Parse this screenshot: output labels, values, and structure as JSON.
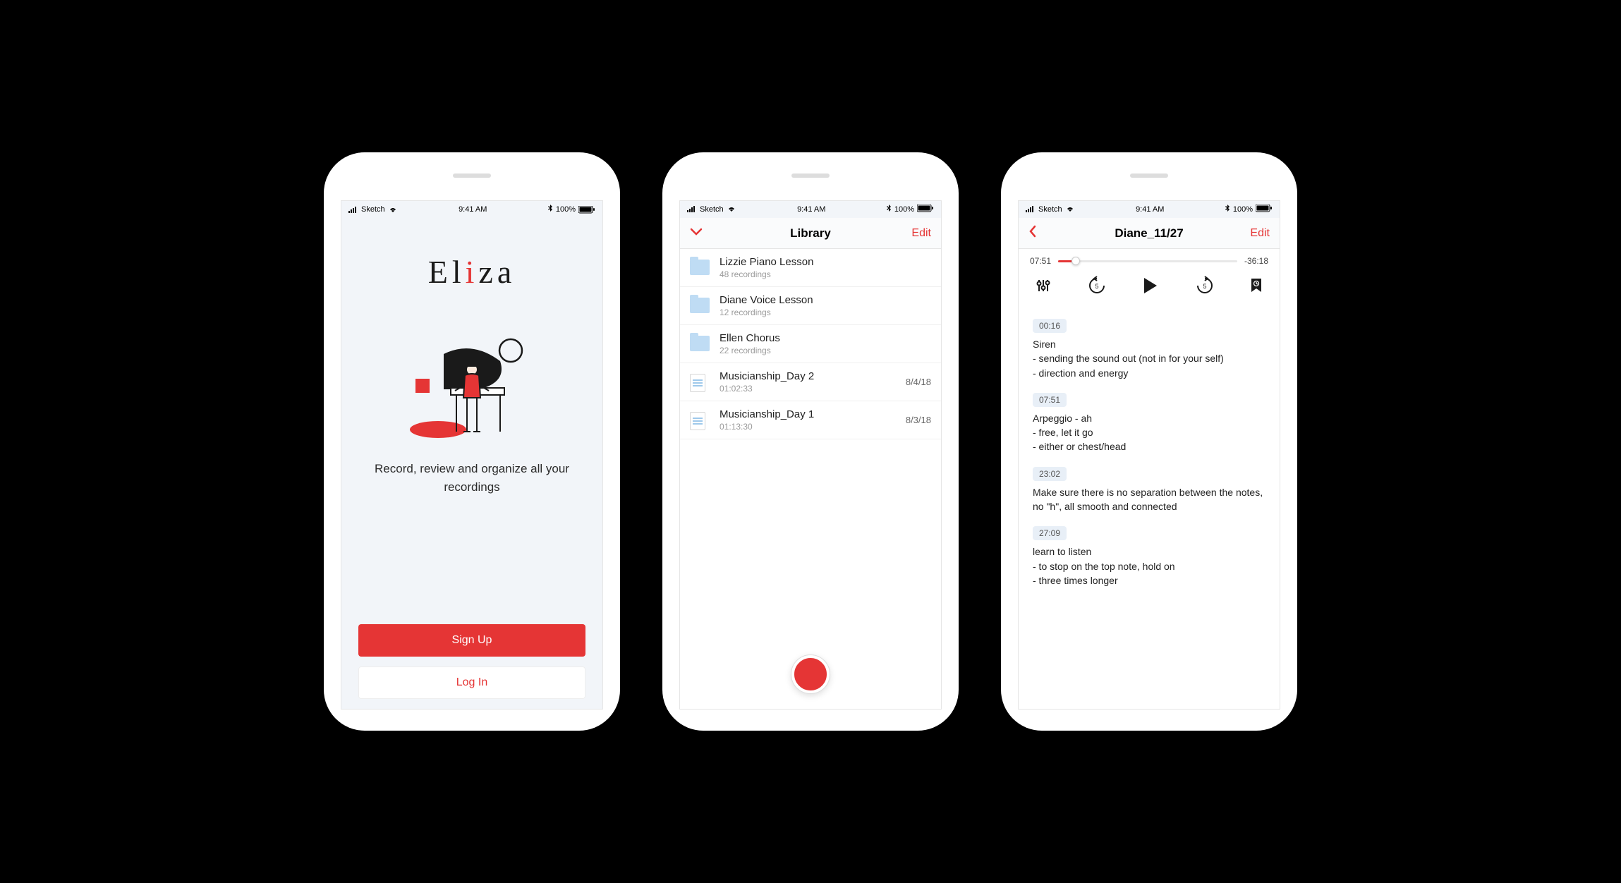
{
  "status": {
    "carrier": "Sketch",
    "time": "9:41 AM",
    "battery": "100%"
  },
  "accent": "#e53535",
  "screen1": {
    "logo_prefix": "El",
    "logo_dot": "i",
    "logo_suffix": "za",
    "tagline": "Record, review and organize\nall your recordings",
    "signup": "Sign Up",
    "login": "Log In"
  },
  "screen2": {
    "title": "Library",
    "edit": "Edit",
    "items": [
      {
        "type": "folder",
        "title": "Lizzie Piano Lesson",
        "sub": "48 recordings",
        "date": ""
      },
      {
        "type": "folder",
        "title": "Diane Voice Lesson",
        "sub": "12 recordings",
        "date": ""
      },
      {
        "type": "folder",
        "title": "Ellen Chorus",
        "sub": "22 recordings",
        "date": ""
      },
      {
        "type": "file",
        "title": "Musicianship_Day 2",
        "sub": "01:02:33",
        "date": "8/4/18"
      },
      {
        "type": "file",
        "title": "Musicianship_Day 1",
        "sub": "01:13:30",
        "date": "8/3/18"
      }
    ]
  },
  "screen3": {
    "title": "Diane_11/27",
    "edit": "Edit",
    "elapsed": "07:51",
    "remaining": "-36:18",
    "notes": [
      {
        "ts": "00:16",
        "text": "Siren\n- sending the sound out (not in for your self)\n- direction and energy"
      },
      {
        "ts": "07:51",
        "text": "Arpeggio - ah\n- free, let it go\n- either or chest/head"
      },
      {
        "ts": "23:02",
        "text": "Make sure there is no separation between the notes, no \"h\", all smooth and connected"
      },
      {
        "ts": "27:09",
        "text": "learn to listen\n- to stop on the top note, hold on\n- three times longer"
      }
    ]
  }
}
